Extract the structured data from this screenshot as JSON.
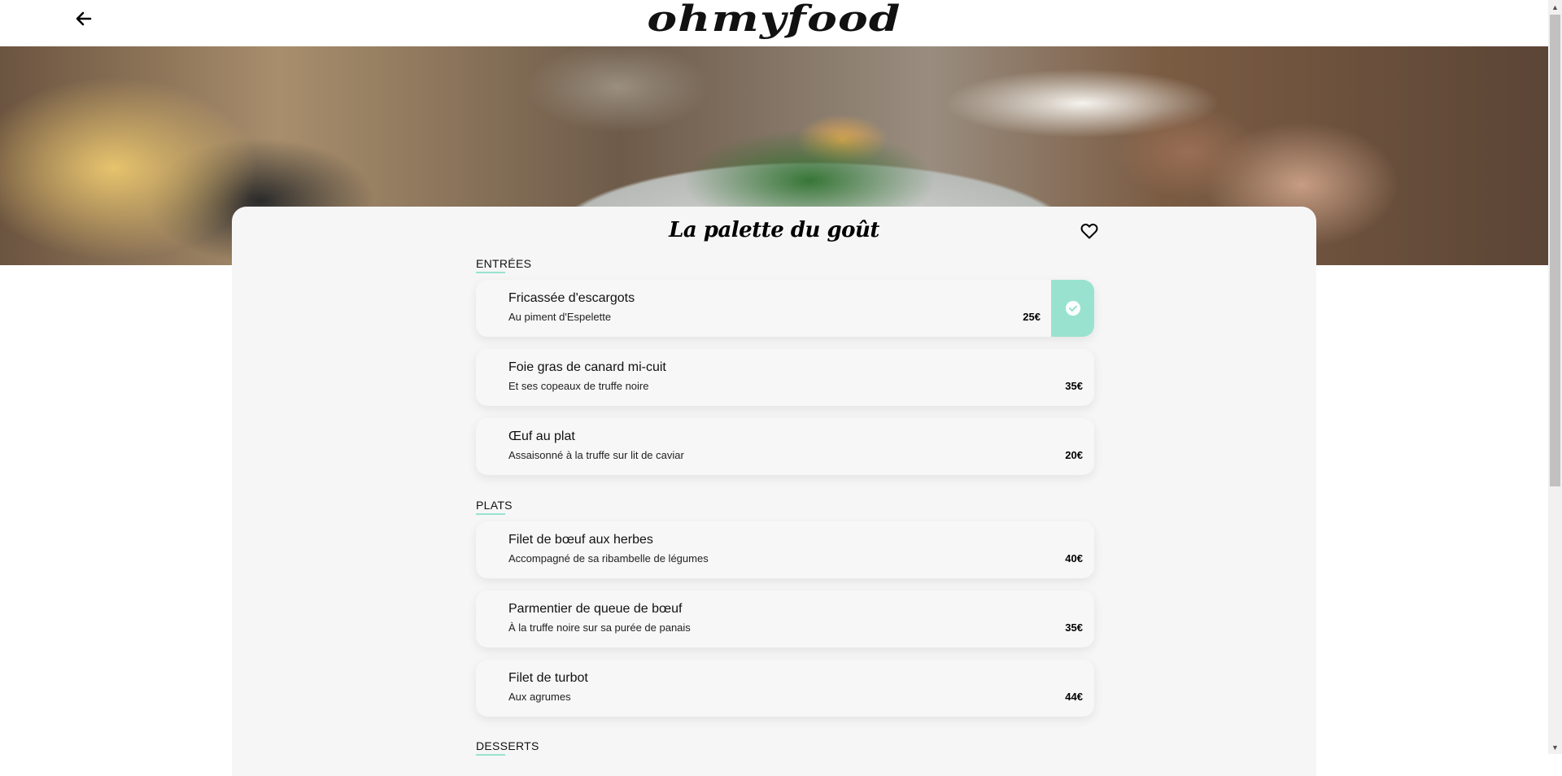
{
  "header": {
    "brand": "ohmyfood",
    "back_icon": "arrow-left-icon"
  },
  "restaurant": {
    "name": "La palette du goût",
    "favorite_icon": "heart-outline-icon"
  },
  "menu": {
    "sections": [
      {
        "title": "ENTRÉES",
        "dishes": [
          {
            "name": "Fricassée d'escargots",
            "description": "Au piment d'Espelette",
            "price": "25€",
            "selected": true
          },
          {
            "name": "Foie gras de canard mi-cuit",
            "description": "Et ses copeaux de truffe noire",
            "price": "35€",
            "selected": false
          },
          {
            "name": "Œuf au plat",
            "description": "Assaisonné à la truffe sur lit de caviar",
            "price": "20€",
            "selected": false
          }
        ]
      },
      {
        "title": "PLATS",
        "dishes": [
          {
            "name": "Filet de bœuf aux herbes",
            "description": "Accompagné de sa ribambelle de légumes",
            "price": "40€",
            "selected": false
          },
          {
            "name": "Parmentier de queue de bœuf",
            "description": "À la truffe noire sur sa purée de panais",
            "price": "35€",
            "selected": false
          },
          {
            "name": "Filet de turbot",
            "description": "Aux agrumes",
            "price": "44€",
            "selected": false
          }
        ]
      },
      {
        "title": "DESSERTS",
        "dishes": []
      }
    ]
  },
  "colors": {
    "accent": "#99e2d0",
    "card_background": "#f6f6f6"
  }
}
